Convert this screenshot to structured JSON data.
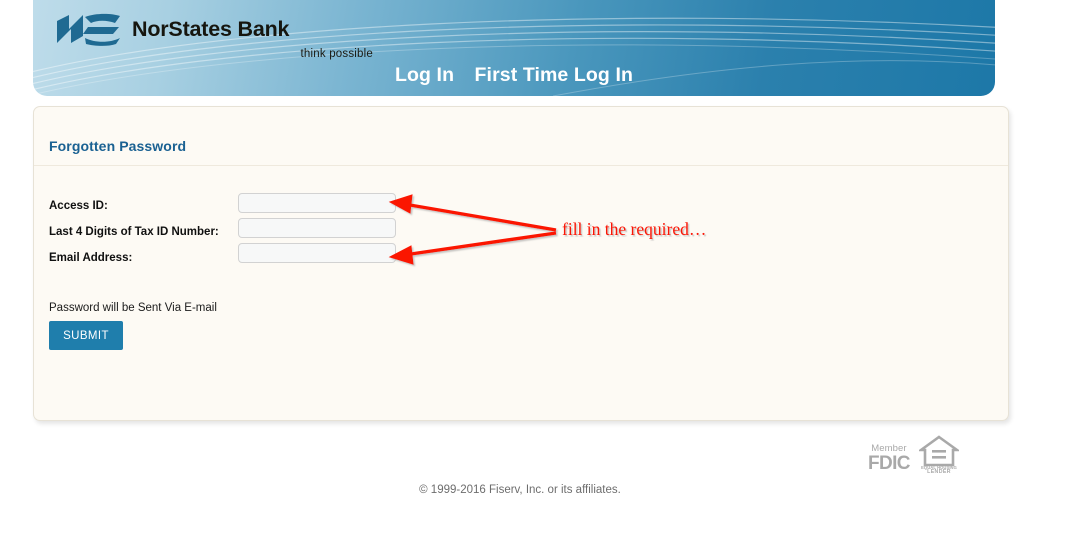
{
  "header": {
    "logo_mark": "ns-monogram-logo",
    "bank_name": "NorStates Bank",
    "tagline": "think possible",
    "nav": [
      {
        "id": "login",
        "label": "Log In"
      },
      {
        "id": "first-time-login",
        "label": "First Time Log In"
      }
    ]
  },
  "panel": {
    "title": "Forgotten Password",
    "fields": [
      {
        "id": "access-id",
        "label": "Access ID:",
        "value": "",
        "placeholder": ""
      },
      {
        "id": "tax-id",
        "label": "Last 4 Digits of Tax ID Number:",
        "value": "",
        "placeholder": ""
      },
      {
        "id": "email",
        "label": "Email Address:",
        "value": "",
        "placeholder": ""
      }
    ],
    "note": "Password will be Sent Via E-mail",
    "submit_label": "SUBMIT"
  },
  "annotation": {
    "text": "fill in the required…",
    "color": "#fb1505",
    "arrow_count": 2
  },
  "footer": {
    "fdic_member": "Member",
    "fdic_name": "FDIC",
    "ehl_line1": "EQUAL HOUSING",
    "ehl_line2": "LENDER",
    "copyright": "© 1999-2016 Fiserv, Inc. or its affiliates."
  },
  "colors": {
    "header_light": "#bedcea",
    "header_dark": "#1d78a8",
    "panel_bg": "#fdfaf4",
    "title_blue": "#1a6192",
    "submit_blue": "#1f7eac",
    "annotation_red": "#fb1505"
  }
}
